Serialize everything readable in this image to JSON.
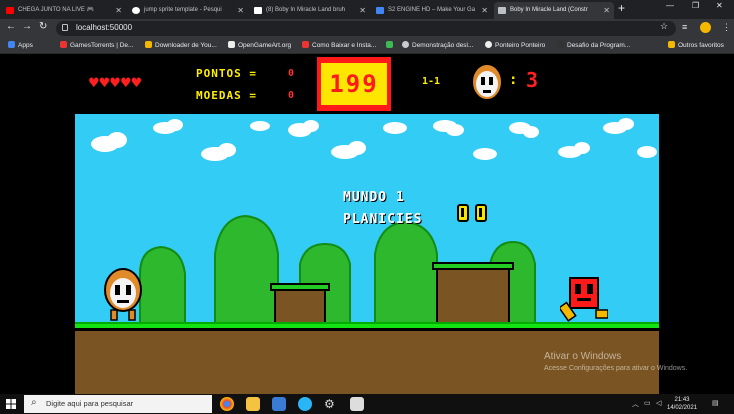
{
  "tabs": [
    {
      "title": "CHEGA JUNTO NA LIVE 🎮",
      "color": "#ff0000",
      "active": false
    },
    {
      "title": "jump sprite template - Pesqui",
      "color": "#ffffff",
      "active": false
    },
    {
      "title": "(8) Boby In Miracle Land bruh",
      "color": "#ffffff",
      "active": false
    },
    {
      "title": "S2 ENGINE HD – Make Your Ga",
      "color": "#4285f4",
      "active": false
    },
    {
      "title": "Boby In Miracle Land (Constr",
      "color": "#bdc1c6",
      "active": true
    }
  ],
  "address_bar": {
    "url": "localhost:50000"
  },
  "bookmarks": [
    {
      "label": "Apps",
      "color": "#4285f4"
    },
    {
      "label": "GamesTorrents | De...",
      "color": "#e33"
    },
    {
      "label": "Downloader de You...",
      "color": "#f5b800"
    },
    {
      "label": "OpenGameArt.org",
      "color": "#eeeeee"
    },
    {
      "label": "Como Baixar e Insta...",
      "color": "#e33"
    },
    {
      "label": "",
      "color": "#3cba54"
    },
    {
      "label": "Demonstração desl...",
      "color": "#cccccc"
    },
    {
      "label": "Ponteiro Ponteiro",
      "color": "#eeeeee"
    },
    {
      "label": "Desafio da Program...",
      "color": "#333"
    },
    {
      "label": "Outros favoritos",
      "color": "#f5b800"
    }
  ],
  "hud": {
    "hearts": "♥♥♥♥♥",
    "points_label": "PONTOS =",
    "points_value": "0",
    "coins_label": "MOEDAS =",
    "coins_value": "0",
    "timer": "199",
    "level": "1-1",
    "lives_colon": ":",
    "lives": "3"
  },
  "game": {
    "world_title": "MUNDO 1",
    "world_subtitle": "PLANICIES"
  },
  "watermark": {
    "title": "Ativar o Windows",
    "subtitle": "Acesse Configurações para ativar o Windows."
  },
  "taskbar": {
    "search_placeholder": "Digite aqui para pesquisar",
    "time": "21:43",
    "date": "14/02/2021"
  }
}
